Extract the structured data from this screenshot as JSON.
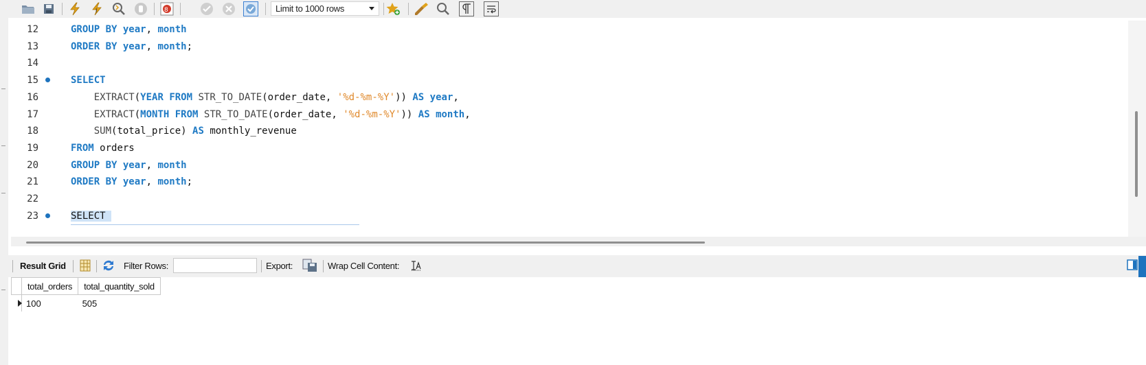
{
  "toolbar": {
    "icons": [
      "open-folder-icon",
      "save-icon",
      "execute-icon",
      "execute-current-icon",
      "explain-icon",
      "stop-icon",
      "toggle-error-icon",
      "commit-icon",
      "rollback-icon",
      "autocommit-icon",
      "add-snippet-icon",
      "beautify-icon",
      "find-icon",
      "invisible-chars-icon",
      "word-wrap-icon"
    ],
    "limit_label": "Limit to 1000 rows"
  },
  "editor": {
    "lines": [
      {
        "num": "12",
        "dot": false,
        "segments": [
          [
            "kw",
            "GROUP BY "
          ],
          [
            "kw",
            "year"
          ],
          [
            "plain",
            ", "
          ],
          [
            "kw",
            "month"
          ]
        ]
      },
      {
        "num": "13",
        "dot": false,
        "segments": [
          [
            "kw",
            "ORDER BY "
          ],
          [
            "kw",
            "year"
          ],
          [
            "plain",
            ", "
          ],
          [
            "kw",
            "month"
          ],
          [
            "plain",
            ";"
          ]
        ]
      },
      {
        "num": "14",
        "dot": false,
        "segments": []
      },
      {
        "num": "15",
        "dot": true,
        "segments": [
          [
            "kw",
            "SELECT"
          ]
        ]
      },
      {
        "num": "16",
        "dot": false,
        "segments": [
          [
            "plain",
            "    "
          ],
          [
            "fn",
            "EXTRACT"
          ],
          [
            "plain",
            "("
          ],
          [
            "kw",
            "YEAR FROM "
          ],
          [
            "fn",
            "STR_TO_DATE"
          ],
          [
            "plain",
            "(order_date, "
          ],
          [
            "str",
            "'%d-%m-%Y'"
          ],
          [
            "plain",
            ")) "
          ],
          [
            "kw",
            "AS "
          ],
          [
            "kw",
            "year"
          ],
          [
            "plain",
            ","
          ]
        ]
      },
      {
        "num": "17",
        "dot": false,
        "segments": [
          [
            "plain",
            "    "
          ],
          [
            "fn",
            "EXTRACT"
          ],
          [
            "plain",
            "("
          ],
          [
            "kw",
            "MONTH FROM "
          ],
          [
            "fn",
            "STR_TO_DATE"
          ],
          [
            "plain",
            "(order_date, "
          ],
          [
            "str",
            "'%d-%m-%Y'"
          ],
          [
            "plain",
            ")) "
          ],
          [
            "kw",
            "AS "
          ],
          [
            "kw",
            "month"
          ],
          [
            "plain",
            ","
          ]
        ]
      },
      {
        "num": "18",
        "dot": false,
        "segments": [
          [
            "plain",
            "    "
          ],
          [
            "fn",
            "SUM"
          ],
          [
            "plain",
            "(total_price) "
          ],
          [
            "kw",
            "AS "
          ],
          [
            "plain",
            "monthly_revenue"
          ]
        ]
      },
      {
        "num": "19",
        "dot": false,
        "segments": [
          [
            "kw",
            "FROM "
          ],
          [
            "plain",
            "orders"
          ]
        ]
      },
      {
        "num": "20",
        "dot": false,
        "segments": [
          [
            "kw",
            "GROUP BY "
          ],
          [
            "kw",
            "year"
          ],
          [
            "plain",
            ", "
          ],
          [
            "kw",
            "month"
          ]
        ]
      },
      {
        "num": "21",
        "dot": false,
        "segments": [
          [
            "kw",
            "ORDER BY "
          ],
          [
            "kw",
            "year"
          ],
          [
            "plain",
            ", "
          ],
          [
            "kw",
            "month"
          ],
          [
            "plain",
            ";"
          ]
        ]
      },
      {
        "num": "22",
        "dot": false,
        "segments": []
      },
      {
        "num": "23",
        "dot": true,
        "segments": [
          [
            "sel",
            "SELECT "
          ]
        ]
      }
    ]
  },
  "result_toolbar": {
    "result_grid_label": "Result Grid",
    "filter_rows_label": "Filter Rows:",
    "filter_value": "",
    "export_label": "Export:",
    "wrap_label": "Wrap Cell Content:"
  },
  "grid": {
    "columns": [
      "total_orders",
      "total_quantity_sold"
    ],
    "rows": [
      [
        "100",
        "505"
      ]
    ]
  },
  "colors": {
    "keyword": "#1f7ac4",
    "string": "#e0892b",
    "accent": "#1e73be"
  }
}
